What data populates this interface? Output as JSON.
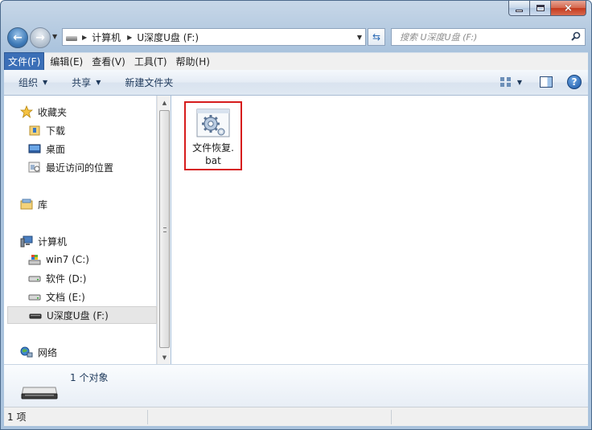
{
  "window": {
    "controls": {
      "minimize": "minimize",
      "maximize": "maximize",
      "close": "×"
    }
  },
  "address": {
    "segments": [
      "计算机",
      "U深度U盘 (F:)"
    ]
  },
  "search": {
    "placeholder": "搜索 U深度U盘 (F:)"
  },
  "menu": [
    "文件(F)",
    "编辑(E)",
    "查看(V)",
    "工具(T)",
    "帮助(H)"
  ],
  "toolbar": {
    "organize": "组织",
    "share": "共享",
    "new_folder": "新建文件夹"
  },
  "nav": {
    "favorites": "收藏夹",
    "downloads": "下载",
    "desktop": "桌面",
    "recent": "最近访问的位置",
    "libraries": "库",
    "computer": "计算机",
    "drive_c": "win7 (C:)",
    "drive_d": "软件 (D:)",
    "drive_e": "文档 (E:)",
    "drive_f": "U深度U盘 (F:)",
    "network": "网络"
  },
  "files": [
    {
      "name_line1": "文件恢复.",
      "name_line2": "bat",
      "icon": "gear-batch-file-icon"
    }
  ],
  "details": {
    "summary": "1 个对象"
  },
  "status": {
    "count": "1 项"
  },
  "colors": {
    "menu_active": "#3b6fb7",
    "highlight_box": "#d61c1c",
    "toolbar_text": "#1e395b"
  }
}
